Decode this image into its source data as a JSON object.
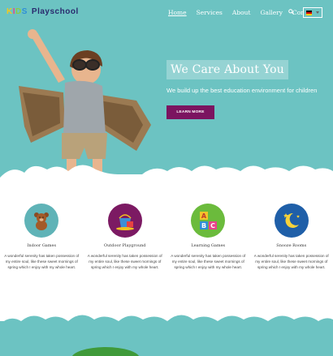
{
  "brand": {
    "logo_letters": [
      "K",
      "I",
      "D",
      "S"
    ],
    "logo_text": "Playschool"
  },
  "nav": {
    "items": [
      "Home",
      "Services",
      "About",
      "Gallery",
      "Contact"
    ],
    "active": "Home"
  },
  "icons": {
    "search": "search-icon",
    "language": "german-flag-icon"
  },
  "hero": {
    "title": "We Care About You",
    "subtitle": "We build up the best education environment for children",
    "cta": "LEARN MORE"
  },
  "features": [
    {
      "title": "Indoor Games",
      "icon": "teddy-bear-icon",
      "color": "#5fb3b7",
      "text": "A wonderful serenity has taken possession of my entire soul, like these sweet mornings of spring which I enjoy with my whole heart."
    },
    {
      "title": "Outdoor Playground",
      "icon": "sand-bucket-icon",
      "color": "#7c1a63",
      "text": "A wonderful serenity has taken possession of my entire soul, like these sweet mornings of spring which I enjoy with my whole heart."
    },
    {
      "title": "Learning Games",
      "icon": "abc-blocks-icon",
      "color": "#6bbb3c",
      "text": "A wonderful serenity has taken possession of my entire soul, like these sweet mornings of spring which I enjoy with my whole heart."
    },
    {
      "title": "Snooze Rooms",
      "icon": "moon-stars-icon",
      "color": "#1f5fa8",
      "text": "A wonderful serenity has taken possession of my entire soul, like these sweet mornings of spring which I enjoy with my whole heart."
    }
  ],
  "colors": {
    "hero_bg": "#6cc3c2",
    "cta_bg": "#7b1460"
  }
}
